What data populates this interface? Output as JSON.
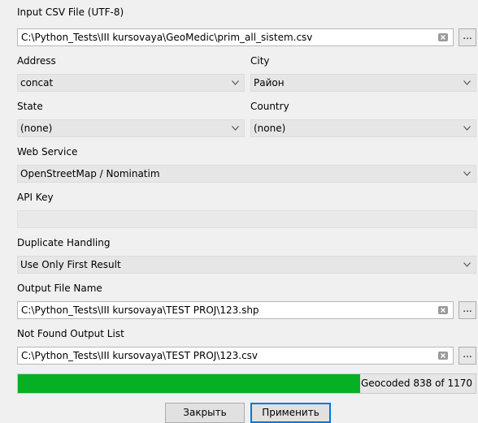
{
  "input_csv": {
    "label": "Input CSV File (UTF-8)",
    "value": "C:\\Python_Tests\\III kursovaya\\GeoMedic\\prim_all_sistem.csv",
    "browse_label": "..."
  },
  "address": {
    "label": "Address",
    "selected": "concat"
  },
  "city": {
    "label": "City",
    "selected": "Район"
  },
  "state": {
    "label": "State",
    "selected": "(none)"
  },
  "country": {
    "label": "Country",
    "selected": "(none)"
  },
  "web_service": {
    "label": "Web Service",
    "selected": "OpenStreetMap / Nominatim"
  },
  "api_key": {
    "label": "API Key",
    "value": ""
  },
  "duplicate_handling": {
    "label": "Duplicate Handling",
    "selected": "Use Only First Result"
  },
  "output_file": {
    "label": "Output File Name",
    "value": "C:\\Python_Tests\\III kursovaya\\TEST PROJ\\123.shp",
    "browse_label": "..."
  },
  "not_found": {
    "label": "Not Found Output List",
    "value": "C:\\Python_Tests\\III kursovaya\\TEST PROJ\\123.csv",
    "browse_label": "..."
  },
  "progress": {
    "text": "Geocoded 838 of 1170",
    "done": 838,
    "total": 1170
  },
  "buttons": {
    "close": "Закрыть",
    "apply": "Применить"
  },
  "colors": {
    "progress_fill": "#06b025",
    "focus": "#0078d7"
  }
}
